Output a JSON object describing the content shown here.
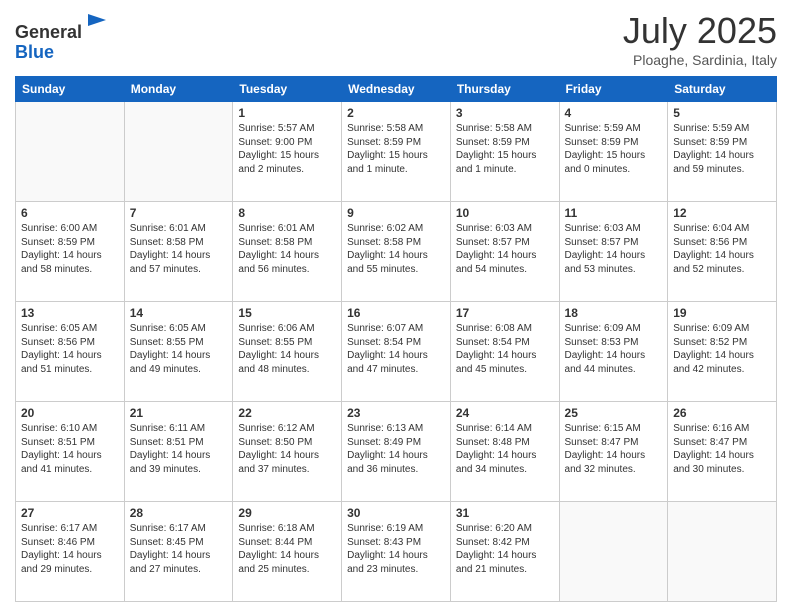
{
  "header": {
    "logo_line1": "General",
    "logo_line2": "Blue",
    "month": "July 2025",
    "location": "Ploaghe, Sardinia, Italy"
  },
  "days_of_week": [
    "Sunday",
    "Monday",
    "Tuesday",
    "Wednesday",
    "Thursday",
    "Friday",
    "Saturday"
  ],
  "weeks": [
    [
      {
        "num": "",
        "detail": ""
      },
      {
        "num": "",
        "detail": ""
      },
      {
        "num": "1",
        "detail": "Sunrise: 5:57 AM\nSunset: 9:00 PM\nDaylight: 15 hours\nand 2 minutes."
      },
      {
        "num": "2",
        "detail": "Sunrise: 5:58 AM\nSunset: 8:59 PM\nDaylight: 15 hours\nand 1 minute."
      },
      {
        "num": "3",
        "detail": "Sunrise: 5:58 AM\nSunset: 8:59 PM\nDaylight: 15 hours\nand 1 minute."
      },
      {
        "num": "4",
        "detail": "Sunrise: 5:59 AM\nSunset: 8:59 PM\nDaylight: 15 hours\nand 0 minutes."
      },
      {
        "num": "5",
        "detail": "Sunrise: 5:59 AM\nSunset: 8:59 PM\nDaylight: 14 hours\nand 59 minutes."
      }
    ],
    [
      {
        "num": "6",
        "detail": "Sunrise: 6:00 AM\nSunset: 8:59 PM\nDaylight: 14 hours\nand 58 minutes."
      },
      {
        "num": "7",
        "detail": "Sunrise: 6:01 AM\nSunset: 8:58 PM\nDaylight: 14 hours\nand 57 minutes."
      },
      {
        "num": "8",
        "detail": "Sunrise: 6:01 AM\nSunset: 8:58 PM\nDaylight: 14 hours\nand 56 minutes."
      },
      {
        "num": "9",
        "detail": "Sunrise: 6:02 AM\nSunset: 8:58 PM\nDaylight: 14 hours\nand 55 minutes."
      },
      {
        "num": "10",
        "detail": "Sunrise: 6:03 AM\nSunset: 8:57 PM\nDaylight: 14 hours\nand 54 minutes."
      },
      {
        "num": "11",
        "detail": "Sunrise: 6:03 AM\nSunset: 8:57 PM\nDaylight: 14 hours\nand 53 minutes."
      },
      {
        "num": "12",
        "detail": "Sunrise: 6:04 AM\nSunset: 8:56 PM\nDaylight: 14 hours\nand 52 minutes."
      }
    ],
    [
      {
        "num": "13",
        "detail": "Sunrise: 6:05 AM\nSunset: 8:56 PM\nDaylight: 14 hours\nand 51 minutes."
      },
      {
        "num": "14",
        "detail": "Sunrise: 6:05 AM\nSunset: 8:55 PM\nDaylight: 14 hours\nand 49 minutes."
      },
      {
        "num": "15",
        "detail": "Sunrise: 6:06 AM\nSunset: 8:55 PM\nDaylight: 14 hours\nand 48 minutes."
      },
      {
        "num": "16",
        "detail": "Sunrise: 6:07 AM\nSunset: 8:54 PM\nDaylight: 14 hours\nand 47 minutes."
      },
      {
        "num": "17",
        "detail": "Sunrise: 6:08 AM\nSunset: 8:54 PM\nDaylight: 14 hours\nand 45 minutes."
      },
      {
        "num": "18",
        "detail": "Sunrise: 6:09 AM\nSunset: 8:53 PM\nDaylight: 14 hours\nand 44 minutes."
      },
      {
        "num": "19",
        "detail": "Sunrise: 6:09 AM\nSunset: 8:52 PM\nDaylight: 14 hours\nand 42 minutes."
      }
    ],
    [
      {
        "num": "20",
        "detail": "Sunrise: 6:10 AM\nSunset: 8:51 PM\nDaylight: 14 hours\nand 41 minutes."
      },
      {
        "num": "21",
        "detail": "Sunrise: 6:11 AM\nSunset: 8:51 PM\nDaylight: 14 hours\nand 39 minutes."
      },
      {
        "num": "22",
        "detail": "Sunrise: 6:12 AM\nSunset: 8:50 PM\nDaylight: 14 hours\nand 37 minutes."
      },
      {
        "num": "23",
        "detail": "Sunrise: 6:13 AM\nSunset: 8:49 PM\nDaylight: 14 hours\nand 36 minutes."
      },
      {
        "num": "24",
        "detail": "Sunrise: 6:14 AM\nSunset: 8:48 PM\nDaylight: 14 hours\nand 34 minutes."
      },
      {
        "num": "25",
        "detail": "Sunrise: 6:15 AM\nSunset: 8:47 PM\nDaylight: 14 hours\nand 32 minutes."
      },
      {
        "num": "26",
        "detail": "Sunrise: 6:16 AM\nSunset: 8:47 PM\nDaylight: 14 hours\nand 30 minutes."
      }
    ],
    [
      {
        "num": "27",
        "detail": "Sunrise: 6:17 AM\nSunset: 8:46 PM\nDaylight: 14 hours\nand 29 minutes."
      },
      {
        "num": "28",
        "detail": "Sunrise: 6:17 AM\nSunset: 8:45 PM\nDaylight: 14 hours\nand 27 minutes."
      },
      {
        "num": "29",
        "detail": "Sunrise: 6:18 AM\nSunset: 8:44 PM\nDaylight: 14 hours\nand 25 minutes."
      },
      {
        "num": "30",
        "detail": "Sunrise: 6:19 AM\nSunset: 8:43 PM\nDaylight: 14 hours\nand 23 minutes."
      },
      {
        "num": "31",
        "detail": "Sunrise: 6:20 AM\nSunset: 8:42 PM\nDaylight: 14 hours\nand 21 minutes."
      },
      {
        "num": "",
        "detail": ""
      },
      {
        "num": "",
        "detail": ""
      }
    ]
  ]
}
